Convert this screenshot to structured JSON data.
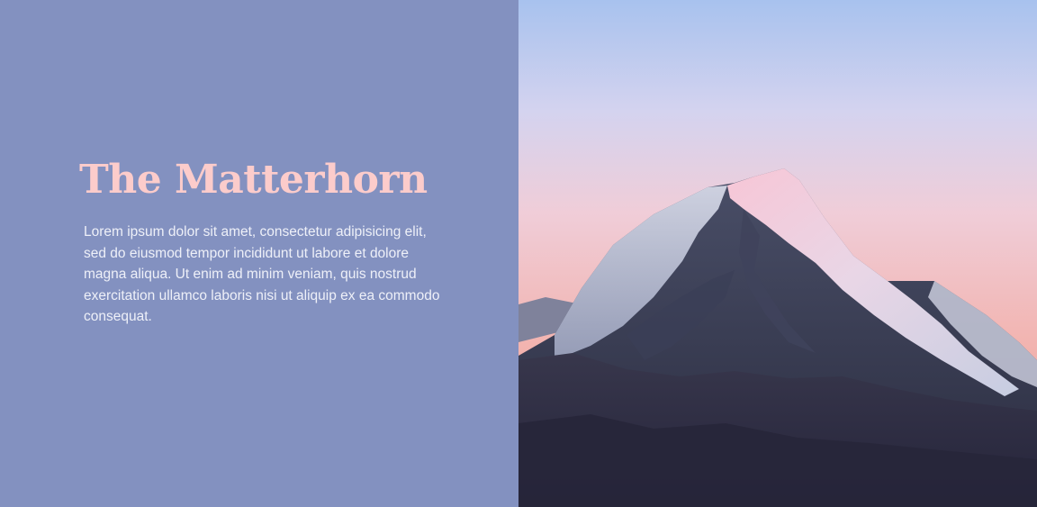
{
  "hero": {
    "title": "The Matterhorn",
    "body": "Lorem ipsum dolor sit amet, consectetur adipisicing elit, sed do eiusmod tempor incididunt ut labore et dolore magna aliqua. Ut enim ad minim veniam, quis nostrud exercitation ullamco laboris nisi ut aliquip ex ea commodo consequat."
  },
  "colors": {
    "panel_background": "#8391c0",
    "title": "#fccccb",
    "body_text": "#eef0f8"
  },
  "image": {
    "subject": "snow-capped-mountain-peak-at-dusk"
  }
}
